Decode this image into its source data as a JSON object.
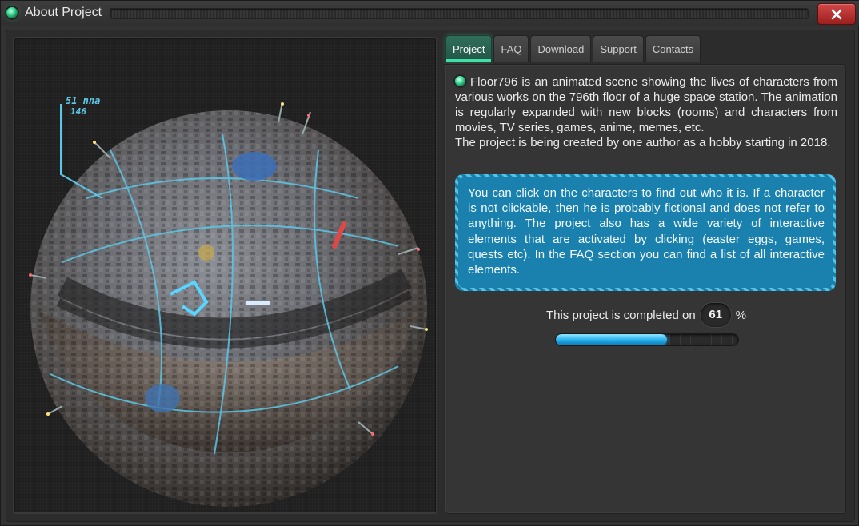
{
  "window": {
    "title": "About Project",
    "close_icon": "close-icon"
  },
  "tabs": [
    {
      "label": "Project",
      "active": true
    },
    {
      "label": "FAQ",
      "active": false
    },
    {
      "label": "Download",
      "active": false
    },
    {
      "label": "Support",
      "active": false
    },
    {
      "label": "Contacts",
      "active": false
    }
  ],
  "image": {
    "overlay_line1": "51 nna",
    "overlay_line2": "146"
  },
  "project": {
    "intro": "Floor796 is an animated scene showing the lives of characters from various works on the 796th floor of a huge space station. The animation is regularly expanded with new blocks (rooms) and characters from movies, TV series, games, anime, memes, etc.",
    "intro2": "The project is being created by one author as a hobby starting in 2018.",
    "info": "You can click on the characters to find out who it is. If a character is not clickable, then he is probably fictional and does not refer to anything. The project also has a wide variety of interactive elements that are activated by clicking (easter eggs, games, quests etc). In the FAQ section you can find a list of all interactive elements.",
    "progress_prefix": "This project is completed on",
    "progress_value": "61",
    "progress_suffix": "%",
    "progress_fraction": 0.61
  },
  "colors": {
    "accent_green": "#3ddc97",
    "info_blue": "#1a80ad",
    "progress_blue": "#1aa7e6",
    "close_red": "#b83232"
  }
}
